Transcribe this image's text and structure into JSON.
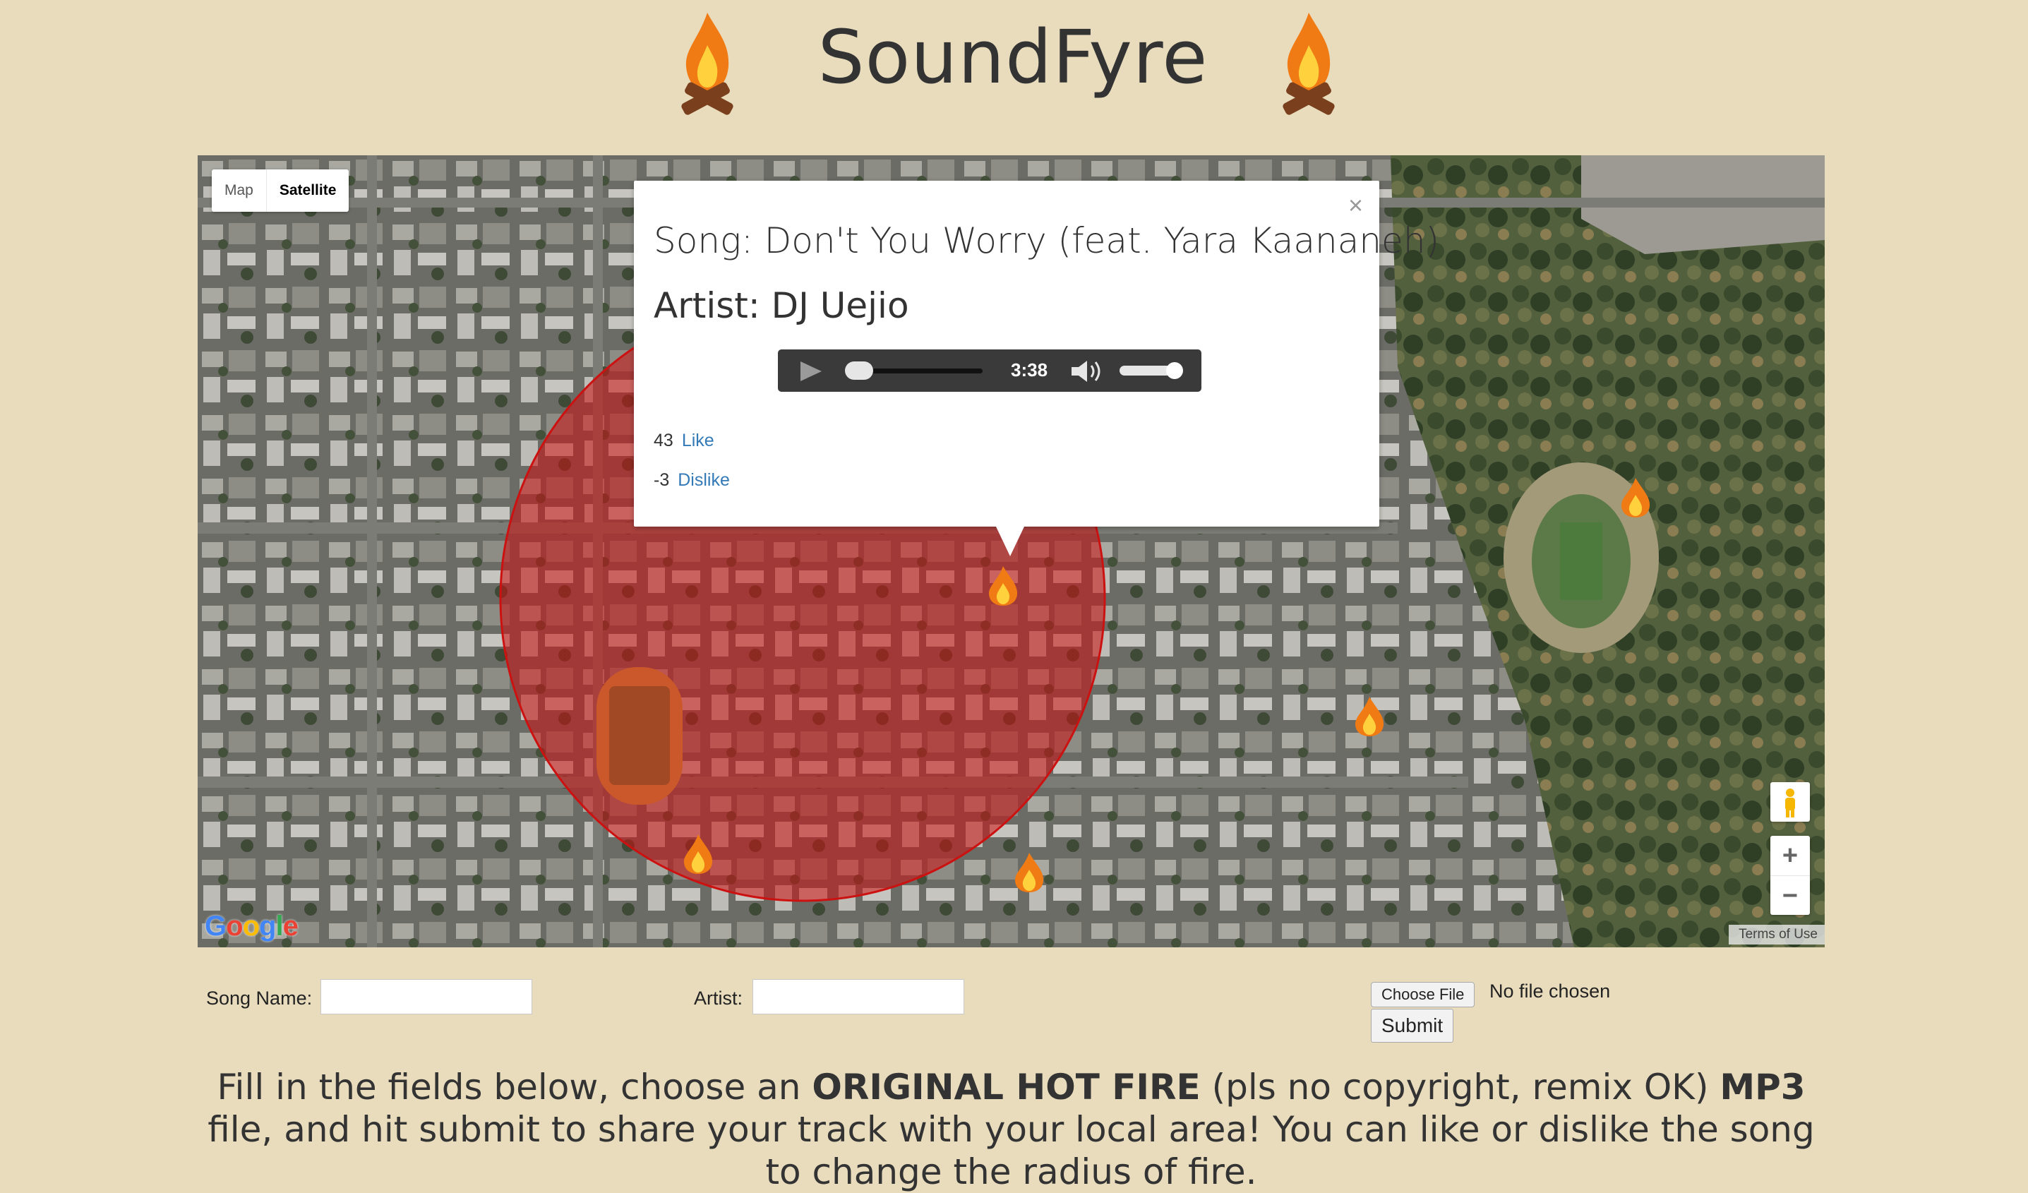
{
  "header": {
    "title": "SoundFyre"
  },
  "map": {
    "map_type": {
      "map_label": "Map",
      "satellite_label": "Satellite",
      "selected": "Satellite"
    },
    "zoom": {
      "in_label": "+",
      "out_label": "−"
    },
    "attribution": {
      "logo_text": "Google",
      "terms_label": "Terms of Use"
    },
    "radius_color": "#cc1111"
  },
  "info_window": {
    "close_label": "×",
    "song_prefix": "Song: ",
    "song_title": "Don't You Worry (feat. Yara Kaananeh)",
    "artist_prefix": "Artist: ",
    "artist_name": "DJ Uejio",
    "player": {
      "duration": "3:38",
      "state": "paused",
      "volume_fraction": 0.75,
      "progress_fraction": 0
    },
    "likes": {
      "count": "43",
      "label": "Like"
    },
    "dislikes": {
      "count": "-3",
      "label": "Dislike"
    }
  },
  "form": {
    "song_name_label": "Song Name:",
    "song_name_value": "",
    "artist_label": "Artist:",
    "artist_value": "",
    "choose_file_label": "Choose File",
    "file_status": "No file chosen",
    "submit_label": "Submit"
  },
  "instructions": {
    "part1": "Fill in the fields below, choose an ",
    "bold1": "ORIGINAL HOT FIRE",
    "part2": " (pls no copyright, remix OK) ",
    "bold2": "MP3",
    "part3": " file, and hit submit to share your track with your local area! You can like or dislike the song to change the radius of fire."
  },
  "colors": {
    "page_bg": "#e8dcbd",
    "link": "#337ab7",
    "fire_orange": "#f07a14",
    "wood": "#7a3f1d"
  }
}
